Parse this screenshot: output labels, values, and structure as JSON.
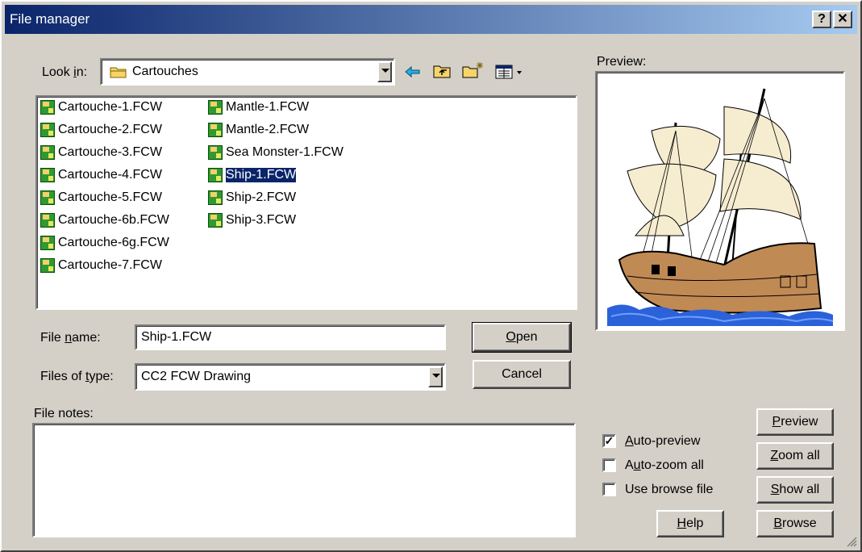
{
  "window": {
    "title": "File manager",
    "help_button": "?",
    "close_button": "✕"
  },
  "lookin": {
    "label_pre": "Look ",
    "label_mnemonic": "i",
    "label_post": "n:",
    "value": "Cartouches"
  },
  "files": {
    "col1": [
      "Cartouche-1.FCW",
      "Cartouche-2.FCW",
      "Cartouche-3.FCW",
      "Cartouche-4.FCW",
      "Cartouche-5.FCW",
      "Cartouche-6b.FCW",
      "Cartouche-6g.FCW",
      "Cartouche-7.FCW"
    ],
    "col2": [
      "Mantle-1.FCW",
      "Mantle-2.FCW",
      "Sea Monster-1.FCW",
      "Ship-1.FCW",
      "Ship-2.FCW",
      "Ship-3.FCW"
    ],
    "selected": "Ship-1.FCW"
  },
  "filename": {
    "label_pre": "File ",
    "label_mnemonic": "n",
    "label_post": "ame:",
    "value": "Ship-1.FCW"
  },
  "filetype": {
    "label_pre": "Files of ",
    "label_mnemonic": "t",
    "label_post": "ype:",
    "value": "CC2 FCW Drawing"
  },
  "buttons": {
    "open_mnemonic": "O",
    "open_rest": "pen",
    "cancel": "Cancel",
    "help_mnemonic": "H",
    "help_rest": "elp",
    "preview_mnemonic": "P",
    "preview_rest": "review",
    "zoom_mnemonic": "Z",
    "zoom_rest": "oom all",
    "show_mnemonic": "S",
    "show_rest": "how all",
    "browse_mnemonic": "B",
    "browse_rest": "rowse"
  },
  "notes": {
    "label": "File notes:"
  },
  "preview": {
    "label": "Preview:"
  },
  "options": [
    {
      "mnemonic": "A",
      "rest": "uto-preview",
      "checked": true
    },
    {
      "pre": "A",
      "mnemonic": "u",
      "rest": "to-zoom all",
      "checked": false
    },
    {
      "mnemonic": "",
      "rest": "Use browse file",
      "checked": false
    }
  ],
  "colors": {
    "titlebar_start": "#0a246a",
    "titlebar_end": "#a6caf0",
    "dialog_bg": "#d4d0c8",
    "selection": "#0a246a"
  },
  "icons": [
    "folder-icon",
    "back-arrow-icon",
    "up-folder-icon",
    "new-folder-icon",
    "view-menu-icon",
    "fcw-file-icon",
    "ship-preview-image"
  ]
}
